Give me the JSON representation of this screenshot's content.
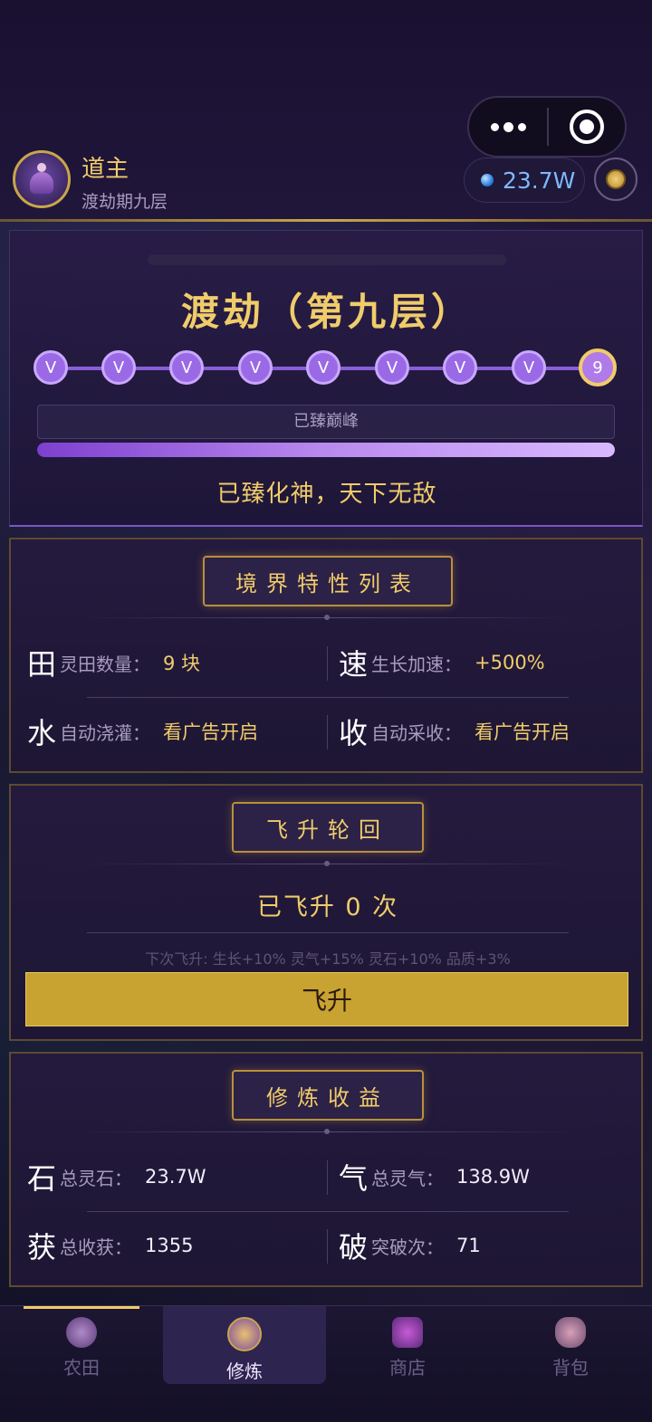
{
  "header": {
    "user_name": "道主",
    "user_realm": "渡劫期九层",
    "spirit_stones": "23.7W",
    "icons": {
      "avatar": "cultivator-avatar",
      "stone": "spirit-stone-icon",
      "coin": "coin-icon"
    }
  },
  "realm": {
    "title": "渡劫（第九层）",
    "stages": [
      "V",
      "V",
      "V",
      "V",
      "V",
      "V",
      "V",
      "V",
      "9"
    ],
    "current_stage": 9,
    "peak_label": "已臻巅峰",
    "progress_percent": 100,
    "motto": "已臻化神，天下无敌"
  },
  "traits": {
    "title": "境界特性列表",
    "items": [
      {
        "glyph": "田",
        "label": "灵田数量：",
        "value": "9 块"
      },
      {
        "glyph": "速",
        "label": "生长加速：",
        "value": "+500%"
      },
      {
        "glyph": "水",
        "label": "自动浇灌：",
        "value": "看广告开启"
      },
      {
        "glyph": "收",
        "label": "自动采收：",
        "value": "看广告开启"
      }
    ]
  },
  "ascension": {
    "title": "飞升轮回",
    "count_text": "已飞升 0 次",
    "next_bonus": "下次飞升: 生长+10%  灵气+15%  灵石+10%  品质+3%",
    "button_label": "飞升"
  },
  "earnings": {
    "title": "修炼收益",
    "items": [
      {
        "glyph": "石",
        "label": "总灵石：",
        "value": "23.7W"
      },
      {
        "glyph": "气",
        "label": "总灵气：",
        "value": "138.9W"
      },
      {
        "glyph": "获",
        "label": "总收获：",
        "value": "1355"
      },
      {
        "glyph": "破",
        "label": "突破次：",
        "value": "71"
      }
    ]
  },
  "tabs": [
    {
      "label": "农田",
      "icon": "farm-icon"
    },
    {
      "label": "修炼",
      "icon": "cultivate-icon"
    },
    {
      "label": "商店",
      "icon": "shop-icon"
    },
    {
      "label": "背包",
      "icon": "bag-icon"
    }
  ],
  "colors": {
    "gold": "#f0cc6a",
    "purple": "#9a6ae6",
    "button": "#c9a331"
  }
}
